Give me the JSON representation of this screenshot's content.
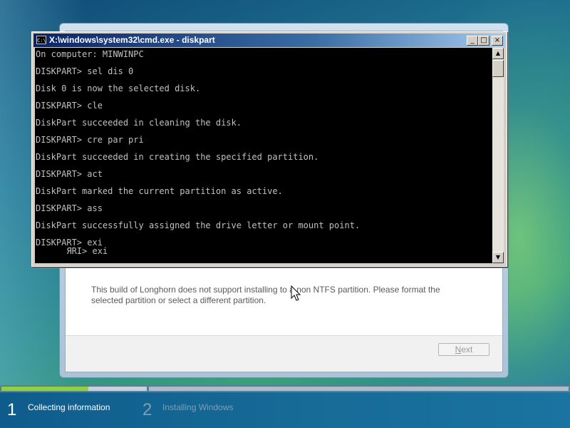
{
  "cmd_window": {
    "title": "X:\\windows\\system32\\cmd.exe - diskpart",
    "icon": "cmd-icon",
    "icon_text": "C:\\",
    "buttons": {
      "minimize": "_",
      "maximize": "□",
      "close": "×"
    },
    "lines": [
      "On computer: MINWINPC",
      "",
      "DISKPART> sel dis 0",
      "",
      "Disk 0 is now the selected disk.",
      "",
      "DISKPART> cle",
      "",
      "DiskPart succeeded in cleaning the disk.",
      "",
      "DISKPART> cre par pri",
      "",
      "DiskPart succeeded in creating the specified partition.",
      "",
      "DISKPART> act",
      "",
      "DiskPart marked the current partition as active.",
      "",
      "DISKPART> ass",
      "",
      "DiskPart successfully assigned the drive letter or mount point.",
      "",
      "DISKPART> exi",
      "      ЯRI> exi"
    ]
  },
  "setup": {
    "message": "This build of Longhorn does not support installing to a non NTFS partition. Please format the selected partition or select a different partition.",
    "next_button": {
      "accel": "N",
      "rest": "ext",
      "enabled": false
    }
  },
  "steps": [
    {
      "number": "1",
      "label": "Collecting information",
      "active": true
    },
    {
      "number": "2",
      "label": "Installing Windows",
      "active": false
    }
  ],
  "progress": {
    "step1_fraction": 0.6
  },
  "colors": {
    "console_bg": "#000000",
    "console_text": "#c0c0c0",
    "progress_fill": "#8fd33b",
    "titlebar": "#0a246a"
  }
}
